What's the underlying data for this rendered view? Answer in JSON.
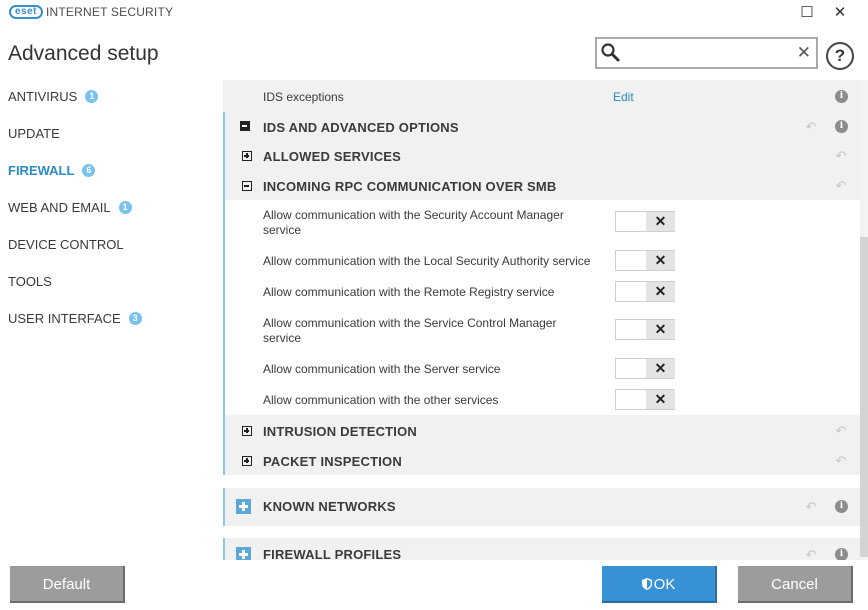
{
  "titlebar": {
    "logo_text": "eset",
    "product_name": "INTERNET SECURITY",
    "minimize_glyph": "☐",
    "close_glyph": "✕"
  },
  "app_title": "Advanced setup",
  "search": {
    "placeholder": "",
    "value": "",
    "clear_glyph": "✕"
  },
  "help_glyph": "?",
  "sidebar": {
    "items": [
      {
        "label": "ANTIVIRUS",
        "badge": "1",
        "active": false
      },
      {
        "label": "UPDATE",
        "badge": "",
        "active": false
      },
      {
        "label": "FIREWALL",
        "badge": "6",
        "active": true
      },
      {
        "label": "WEB AND EMAIL",
        "badge": "1",
        "active": false
      },
      {
        "label": "DEVICE CONTROL",
        "badge": "",
        "active": false
      },
      {
        "label": "TOOLS",
        "badge": "",
        "active": false
      },
      {
        "label": "USER INTERFACE",
        "badge": "3",
        "active": false
      }
    ]
  },
  "main": {
    "ids_exceptions": {
      "label": "IDS exceptions",
      "link": "Edit"
    },
    "ids_advanced_header": "IDS AND ADVANCED OPTIONS",
    "allowed_services_header": "ALLOWED SERVICES",
    "rpc_header": "INCOMING RPC COMMUNICATION OVER SMB",
    "rpc_options": [
      {
        "label_line1": "Allow communication with the Security Account Manager",
        "label_line2": "service",
        "value": false
      },
      {
        "label_line1": "Allow communication with the Local Security Authority service",
        "label_line2": "",
        "value": false
      },
      {
        "label_line1": "Allow communication with the Remote Registry service",
        "label_line2": "",
        "value": false
      },
      {
        "label_line1": "Allow communication with the Service Control Manager",
        "label_line2": "service",
        "value": false
      },
      {
        "label_line1": "Allow communication with the Server service",
        "label_line2": "",
        "value": false
      },
      {
        "label_line1": "Allow communication with the other services",
        "label_line2": "",
        "value": false
      }
    ],
    "toggle_off_glyph": "✕",
    "intrusion_header": "INTRUSION DETECTION",
    "packet_header": "PACKET INSPECTION",
    "known_networks_header": "KNOWN NETWORKS",
    "firewall_profiles_header": "FIREWALL PROFILES",
    "info_glyph": "i",
    "revert_glyph": "↶"
  },
  "footer": {
    "default_label": "Default",
    "ok_label": "OK",
    "cancel_label": "Cancel"
  },
  "colors": {
    "accent": "#2b8cc4",
    "badge": "#79c2ee",
    "ok_button": "#3891d4",
    "gray_button": "#9c9c9c"
  }
}
